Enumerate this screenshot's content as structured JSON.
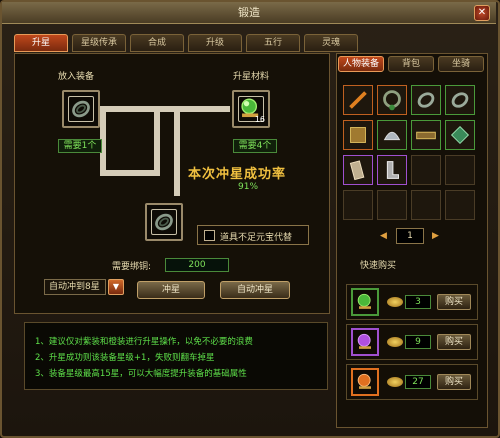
{
  "window": {
    "title": "锻造",
    "close_glyph": "✕"
  },
  "tabs": [
    {
      "label": "升星"
    },
    {
      "label": "星级传承"
    },
    {
      "label": "合成"
    },
    {
      "label": "升级"
    },
    {
      "label": "五行"
    },
    {
      "label": "灵魂"
    }
  ],
  "upgrade": {
    "equip_label": "放入装备",
    "material_label": "升星材料",
    "equip_need": "需要1个",
    "material_need": "需要4个",
    "material_count": "16",
    "rate_title": "本次冲星成功率",
    "rate_value": "91%",
    "substitute_label": "道具不足元宝代替",
    "cost_label": "需要绑铜:",
    "cost_value": "200",
    "auto_select": "自动冲到8星",
    "star_button": "冲星",
    "auto_button": "自动冲星"
  },
  "tips": [
    "1、建议仅对紫装和橙装进行升星操作，以免不必要的浪费",
    "2、升星成功则该装备星级+1，失败则翻车掉星",
    "3、装备星级最高15星，可以大幅度提升装备的基础属性"
  ],
  "inventory": {
    "tabs": [
      {
        "label": "人物装备"
      },
      {
        "label": "背包"
      },
      {
        "label": "坐骑"
      }
    ],
    "page": "1",
    "quick_buy_title": "快速购买",
    "quick_buy": [
      {
        "count": "3",
        "buy_label": "购买",
        "color": "#6ad040"
      },
      {
        "count": "9",
        "buy_label": "购买",
        "color": "#b050e0"
      },
      {
        "count": "27",
        "buy_label": "购买",
        "color": "#e07020"
      }
    ]
  }
}
